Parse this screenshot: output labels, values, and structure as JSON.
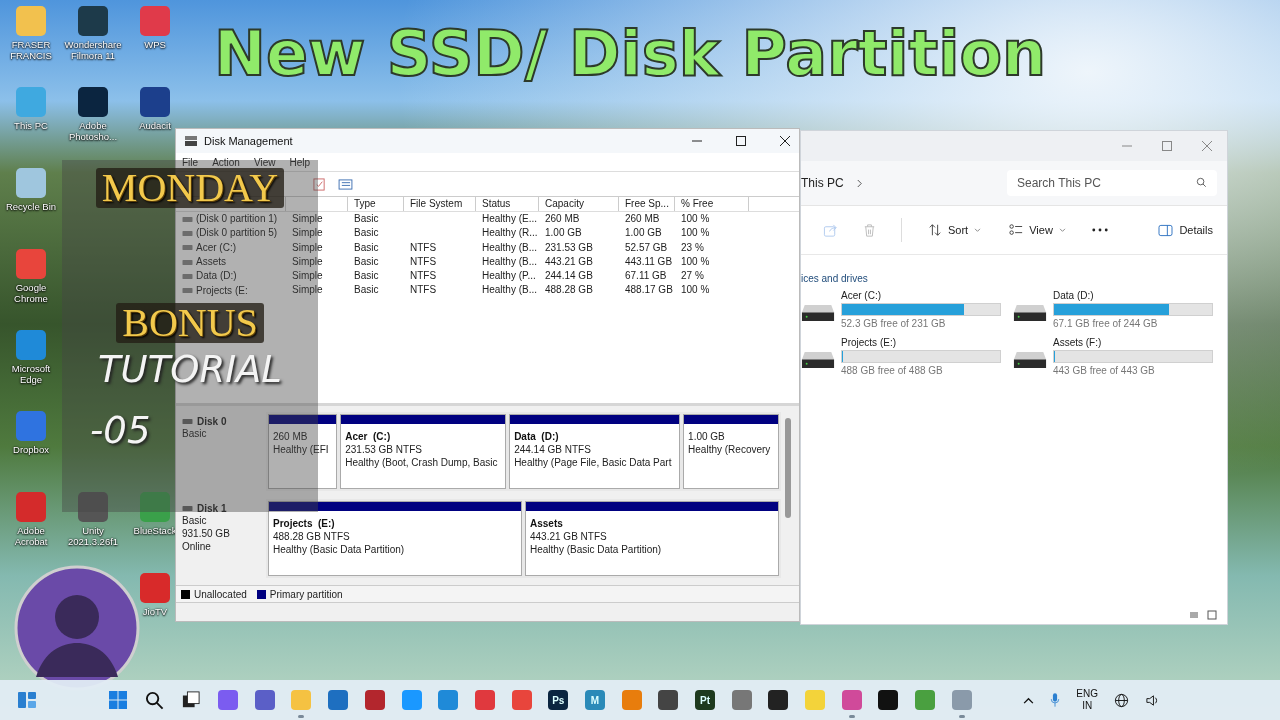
{
  "headline": "New SSD/ Disk Partition",
  "overlay": {
    "lines": [
      {
        "text": "MONDAY",
        "kind": "gold"
      },
      {
        "text": "BONUS",
        "kind": "gold"
      },
      {
        "text": "TUTORIAL",
        "kind": "chalk"
      },
      {
        "text": "-05",
        "kind": "chalk"
      }
    ]
  },
  "desktop_icons": [
    [
      {
        "label": "FRASER FRANCIS",
        "color": "#f2c14e"
      },
      {
        "label": "This PC",
        "color": "#3fa9e0"
      },
      {
        "label": "Recycle Bin",
        "color": "#9fc6de"
      },
      {
        "label": "Google Chrome",
        "color": "#e8453c"
      },
      {
        "label": "Microsoft Edge",
        "color": "#1f8ad8"
      },
      {
        "label": "Dropbox",
        "color": "#2f73e0"
      },
      {
        "label": "Adobe Acrobat",
        "color": "#d42b2b"
      }
    ],
    [
      {
        "label": "Wondershare Filmora 11",
        "color": "#1d3a4a"
      },
      {
        "label": "Adobe Photosho...",
        "color": "#0b2540"
      },
      {
        "label": "Unity 2021.3.26f1",
        "color": "#555555"
      }
    ],
    [
      {
        "label": "WPS",
        "color": "#e03a4a"
      },
      {
        "label": "Audacit",
        "color": "#1c3f8c"
      },
      {
        "label": "BlueStack",
        "color": "#3aa04a"
      },
      {
        "label": "JioTV",
        "color": "#d82a2a"
      }
    ]
  ],
  "disk_management": {
    "title": "Disk Management",
    "menu": [
      "File",
      "Action",
      "View",
      "Help"
    ],
    "columns": [
      {},
      {},
      {
        "label": "Type"
      },
      {
        "label": "File System"
      },
      {
        "label": "Status"
      },
      {
        "label": "Capacity"
      },
      {
        "label": "Free Sp..."
      },
      {
        "label": "% Free"
      }
    ],
    "rows": [
      {
        "volume": "(Disk 0 partition 1)",
        "layout": "Simple",
        "type": "Basic",
        "status": "Healthy (E...",
        "capacity": "260 MB",
        "free_space": "260 MB",
        "percent_free": "100 %"
      },
      {
        "volume": "(Disk 0 partition 5)",
        "layout": "Simple",
        "type": "Basic",
        "status": "Healthy (R...",
        "capacity": "1.00 GB",
        "free_space": "1.00 GB",
        "percent_free": "100 %"
      },
      {
        "volume": "Acer (C:)",
        "layout": "Simple",
        "type": "Basic",
        "file_system": "NTFS",
        "status": "Healthy (B...",
        "capacity": "231.53 GB",
        "free_space": "52.57 GB",
        "percent_free": "23 %"
      },
      {
        "volume": "Assets",
        "layout": "Simple",
        "type": "Basic",
        "file_system": "NTFS",
        "status": "Healthy (B...",
        "capacity": "443.21 GB",
        "free_space": "443.11 GB",
        "percent_free": "100 %"
      },
      {
        "volume": "Data (D:)",
        "layout": "Simple",
        "type": "Basic",
        "file_system": "NTFS",
        "status": "Healthy (P...",
        "capacity": "244.14 GB",
        "free_space": "67.11 GB",
        "percent_free": "27 %"
      },
      {
        "volume": "Projects (E:",
        "layout": "Simple",
        "type": "Basic",
        "file_system": "NTFS",
        "status": "Healthy (B...",
        "capacity": "488.28 GB",
        "free_space": "488.17 GB",
        "percent_free": "100 %"
      }
    ],
    "disks": [
      {
        "name": "Disk 0",
        "info": [
          "Basic"
        ],
        "partitions": [
          {
            "kind": "primary",
            "size": "260 MB",
            "status": "Healthy (EFI"
          },
          {
            "kind": "primary",
            "name": "Acer  (C:)",
            "size": "231.53 GB NTFS",
            "status": "Healthy (Boot, Crash Dump, Basic"
          },
          {
            "kind": "primary",
            "name": "Data  (D:)",
            "size": "244.14 GB NTFS",
            "status": "Healthy (Page File, Basic Data Part"
          },
          {
            "kind": "primary",
            "size": "1.00 GB",
            "status": "Healthy (Recovery"
          }
        ]
      },
      {
        "name": "Disk 1",
        "info": [
          "Basic",
          "931.50 GB",
          "Online"
        ],
        "partitions": [
          {
            "kind": "primary",
            "name": "Projects  (E:)",
            "size": "488.28 GB NTFS",
            "status": "Healthy (Basic Data Partition)"
          },
          {
            "kind": "primary",
            "name": "Assets",
            "size": "443.21 GB NTFS",
            "status": "Healthy (Basic Data Partition)"
          }
        ]
      }
    ],
    "legend": [
      {
        "kind": "unallocated",
        "label": "Unallocated"
      },
      {
        "kind": "primary",
        "label": "Primary partition"
      }
    ]
  },
  "explorer": {
    "breadcrumb": "This PC",
    "search": {
      "placeholder": "Search This PC"
    },
    "toolbar": [
      {
        "kind": "share",
        "disabled": true
      },
      {
        "kind": "delete",
        "disabled": true
      },
      {
        "kind": "sort",
        "label": "Sort",
        "disabled": false
      },
      {
        "kind": "view",
        "label": "View",
        "disabled": false
      },
      {
        "kind": "more",
        "disabled": false
      }
    ],
    "details": "Details",
    "section": "ices and drives",
    "drives": [
      {
        "label": "Acer (C:)",
        "level": 0.77,
        "free": "52.3 GB free of 231 GB"
      },
      {
        "label": "Data (D:)",
        "level": 0.73,
        "free": "67.1 GB free of 244 GB"
      },
      {
        "label": "Projects (E:)",
        "level": 0,
        "free": "488 GB free of 488 GB"
      },
      {
        "label": "Assets (F:)",
        "level": 0,
        "free": "443 GB free of 443 GB"
      }
    ]
  },
  "taskbar": {
    "items": [
      {
        "kind": "widgets",
        "running": false
      },
      {
        "kind": "start",
        "running": false
      },
      {
        "kind": "search",
        "running": false
      },
      {
        "kind": "taskview",
        "running": false
      },
      {
        "kind": "app",
        "color": "#7b5cf0",
        "running": false
      },
      {
        "kind": "app",
        "color": "#5b5fc7",
        "running": false
      },
      {
        "kind": "app",
        "color": "#f5c242",
        "running": true
      },
      {
        "kind": "app",
        "color": "#1e6fc0",
        "running": false
      },
      {
        "kind": "app",
        "color": "#b3262d",
        "running": false
      },
      {
        "kind": "app",
        "color": "#1a98ff",
        "running": false
      },
      {
        "kind": "app",
        "color": "#1f8ad8",
        "running": false
      },
      {
        "kind": "app",
        "color": "#e0393e",
        "running": false
      },
      {
        "kind": "app",
        "color": "#e8453c",
        "running": false
      },
      {
        "kind": "app",
        "color": "#0b2540",
        "glyph": "Ps",
        "running": false
      },
      {
        "kind": "app",
        "color": "#2a8ab8",
        "glyph": "M",
        "running": false
      },
      {
        "kind": "app",
        "color": "#e87d0d",
        "running": false
      },
      {
        "kind": "app",
        "color": "#444444",
        "running": false
      },
      {
        "kind": "app",
        "color": "#1e3a1e",
        "glyph": "Pt",
        "running": false
      },
      {
        "kind": "app",
        "color": "#777777",
        "running": false
      },
      {
        "kind": "app",
        "color": "#222222",
        "running": false
      },
      {
        "kind": "app",
        "color": "#f3d33a",
        "running": false
      },
      {
        "kind": "app",
        "color": "#d04a9a",
        "running": true
      },
      {
        "kind": "app",
        "color": "#111111",
        "running": false
      },
      {
        "kind": "app",
        "color": "#4aa040",
        "running": false
      },
      {
        "kind": "app",
        "color": "#8a9aaa",
        "running": true
      }
    ],
    "language": "ENG",
    "region": "IN"
  }
}
